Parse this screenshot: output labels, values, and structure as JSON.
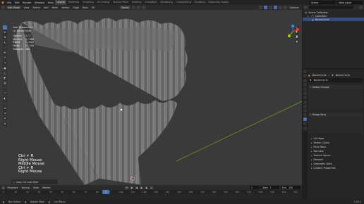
{
  "menubar": {
    "menus": [
      "File",
      "Edit",
      "Render",
      "Window",
      "Help"
    ],
    "workspaces": [
      "Layout",
      "Modeling",
      "Sculpting",
      "UV Editing",
      "Texture Paint",
      "Shading",
      "Animation",
      "Rendering",
      "Compositing",
      "Scripting",
      "Geometry Nodes"
    ],
    "active_workspace": "Layout",
    "scene": "Scene",
    "view_layer": "View Layer"
  },
  "viewport_header": {
    "mode": "Edit Mode",
    "menus": [
      "View",
      "Select",
      "Add",
      "Mesh",
      "Vertex",
      "Edge",
      "Face",
      "UV"
    ],
    "orientation": "Global",
    "options": "Options"
  },
  "overlay": {
    "view_name": "User Perspective",
    "object_name": "(1) BezierCircle",
    "stats": [
      {
        "label": "Objects",
        "value": "1 / 1"
      },
      {
        "label": "Vertices",
        "value": "1 / 288"
      },
      {
        "label": "Edges",
        "value": "1 / 432"
      },
      {
        "label": "Faces",
        "value": "0 / 144"
      },
      {
        "label": "Triangles",
        "value": "288"
      }
    ]
  },
  "keystrokes": [
    "Ctrl + R",
    "Right Mouse",
    "Middle Mouse",
    "Ctrl + R",
    "Right Mouse"
  ],
  "last_operator": "Loop Cut and Slide",
  "timeline": {
    "menus": [
      "Playback",
      "Keying",
      "View",
      "Marker"
    ],
    "current_frame": "1",
    "start_label": "Start",
    "start": "1",
    "end_label": "End",
    "end": "250",
    "ticks": [
      "0",
      "10",
      "20",
      "30",
      "40",
      "50",
      "60",
      "70",
      "80",
      "90",
      "100",
      "110",
      "120",
      "130",
      "140",
      "150",
      "160",
      "170",
      "180",
      "190",
      "200",
      "210",
      "220",
      "230",
      "240",
      "250"
    ]
  },
  "statusbar": {
    "items": [
      "Box Select",
      "Rotate View",
      "Call Menu"
    ],
    "version": "2.93.1"
  },
  "outliner": {
    "title": "Scene Collection",
    "rows": [
      {
        "label": "Collection",
        "selected": false
      },
      {
        "label": "BezierCircle",
        "selected": true
      }
    ]
  },
  "properties": {
    "breadcrumb_object": "BezierCircle",
    "breadcrumb_data": "BezierCircle",
    "data_name": "BezierCircle",
    "panels": [
      "Vertex Groups",
      "Shape Keys"
    ],
    "collapsed": [
      "UV Maps",
      "Vertex Colors",
      "Face Maps",
      "Normals",
      "Texture Space",
      "Remesh",
      "Geometry Data",
      "Custom Properties"
    ]
  },
  "colors": {
    "accent": "#4772b3",
    "viewport_bg": "#3a3a3a",
    "mesh": "#8a8a8a",
    "x_axis": "#ff3352",
    "y_axis": "#8bdc00"
  }
}
